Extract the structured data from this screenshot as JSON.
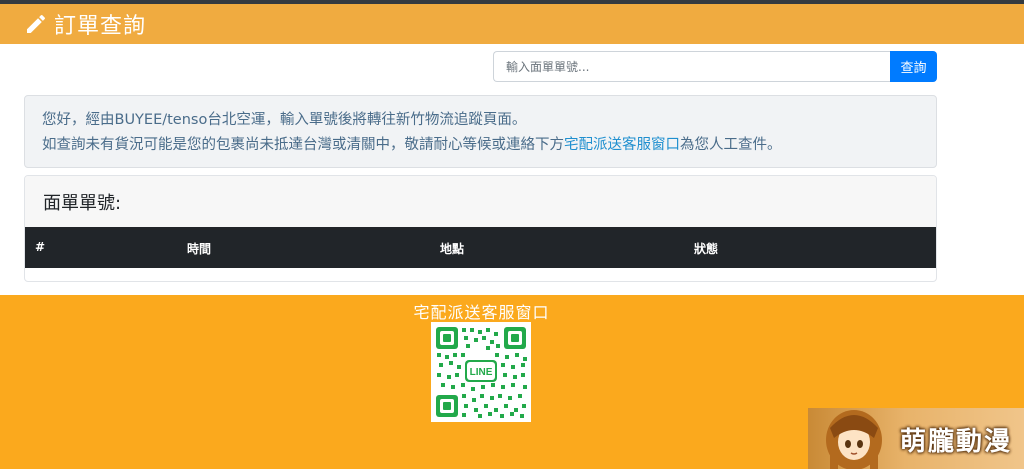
{
  "header": {
    "title": "訂單查詢",
    "icon": "pencil-icon",
    "background": "#f0ab40"
  },
  "search": {
    "placeholder": "輸入面單單號...",
    "value": "",
    "button_label": "查詢",
    "button_color": "#007bff"
  },
  "notice": {
    "line1": "您好，經由BUYEE/tenso台北空運，輸入單號後將轉往新竹物流追蹤頁面。",
    "line2_before": "如查詢未有貨況可能是您的包裹尚未抵達台灣或清關中，敬請耐心等候或連絡下方",
    "line2_link": "宅配派送客服窗口",
    "line2_after": "為您人工查件。"
  },
  "tracking": {
    "title": "面單單號:",
    "columns": [
      "#",
      "時間",
      "地點",
      "狀態"
    ]
  },
  "footer": {
    "title": "宅配派送客服窗口",
    "qr_label": "LINE",
    "background": "#fba91d"
  },
  "watermark": {
    "text": "萌朧動漫"
  }
}
